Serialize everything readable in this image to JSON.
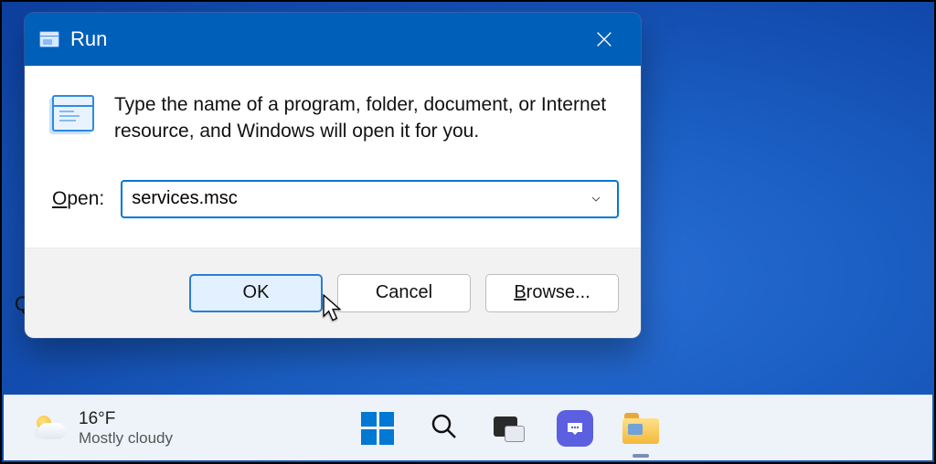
{
  "run_dialog": {
    "title": "Run",
    "instruction": "Type the name of a program, folder, document, or Internet resource, and Windows will open it for you.",
    "open_label_prefix": "O",
    "open_label_rest": "pen:",
    "input_value": "services.msc",
    "buttons": {
      "ok": "OK",
      "cancel": "Cancel",
      "browse_prefix": "B",
      "browse_rest": "rowse..."
    }
  },
  "desktop": {
    "partial_text": "Q"
  },
  "taskbar": {
    "weather": {
      "temperature": "16°F",
      "condition": "Mostly cloudy"
    }
  }
}
